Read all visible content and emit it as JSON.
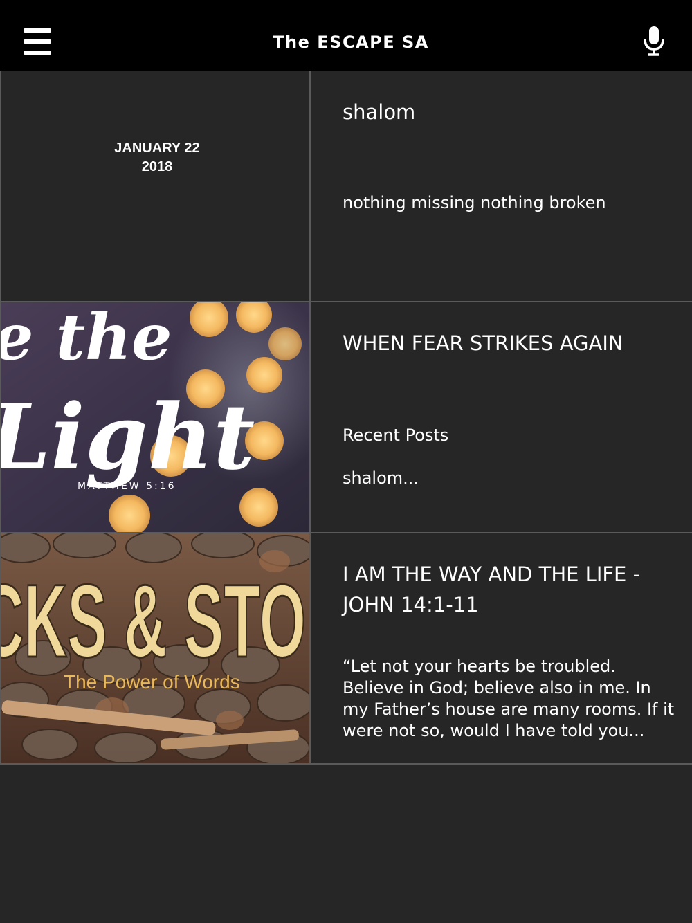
{
  "header": {
    "title": "The ESCAPE SA",
    "menu_icon": "hamburger-menu-icon",
    "mic_icon": "microphone-icon"
  },
  "posts": [
    {
      "date_line1": "JANUARY 22",
      "date_line2": "2018",
      "title": "shalom",
      "excerpt": "nothing missing nothing broken"
    },
    {
      "image_text_main": "e the\nLight",
      "image_text_ref": "MATTHEW 5:16",
      "title": "WHEN FEAR STRIKES AGAIN",
      "excerpt_line1": "Recent Posts",
      "excerpt_line2": "shalom..."
    },
    {
      "image_text_main": "CKS & STO",
      "image_text_sub": "The Power of Words",
      "title": "I AM THE WAY AND THE LIFE - JOHN 14:1-11",
      "excerpt": "“Let not your hearts be troubled. Believe in God; believe also in me. In my Father’s house are many rooms. If it were not so, would I have told you..."
    }
  ],
  "colors": {
    "header_bg": "#000000",
    "page_bg": "#262626",
    "divider": "#5a5a5a",
    "text": "#ffffff"
  }
}
